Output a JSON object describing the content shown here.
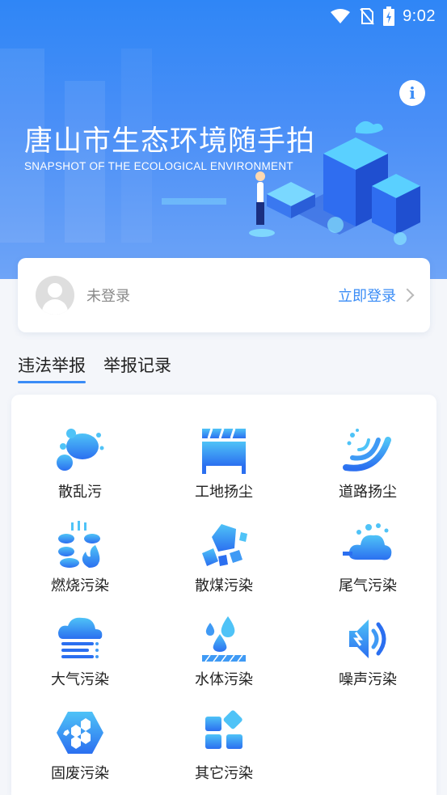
{
  "status_bar": {
    "time": "9:02",
    "icons": [
      "wifi-icon",
      "no-sim-icon",
      "battery-charging-icon"
    ]
  },
  "header": {
    "title": "唐山市生态环境随手拍",
    "subtitle": "SNAPSHOT OF THE ECOLOGICAL ENVIRONMENT",
    "info_icon": "i"
  },
  "login": {
    "status": "未登录",
    "action": "立即登录"
  },
  "tabs": [
    {
      "label": "违法举报",
      "active": true
    },
    {
      "label": "举报记录",
      "active": false
    }
  ],
  "categories": [
    {
      "label": "散乱污",
      "icon": "scattered-pollution-icon"
    },
    {
      "label": "工地扬尘",
      "icon": "construction-dust-icon"
    },
    {
      "label": "道路扬尘",
      "icon": "road-dust-icon"
    },
    {
      "label": "燃烧污染",
      "icon": "burning-pollution-icon"
    },
    {
      "label": "散煤污染",
      "icon": "loose-coal-icon"
    },
    {
      "label": "尾气污染",
      "icon": "exhaust-icon"
    },
    {
      "label": "大气污染",
      "icon": "air-pollution-icon"
    },
    {
      "label": "水体污染",
      "icon": "water-pollution-icon"
    },
    {
      "label": "噪声污染",
      "icon": "noise-icon"
    },
    {
      "label": "固废污染",
      "icon": "solid-waste-icon"
    },
    {
      "label": "其它污染",
      "icon": "other-pollution-icon"
    }
  ],
  "colors": {
    "accent": "#3a8cf6",
    "icon_light": "#4fc3f7",
    "icon_dark": "#2b6ff0"
  }
}
